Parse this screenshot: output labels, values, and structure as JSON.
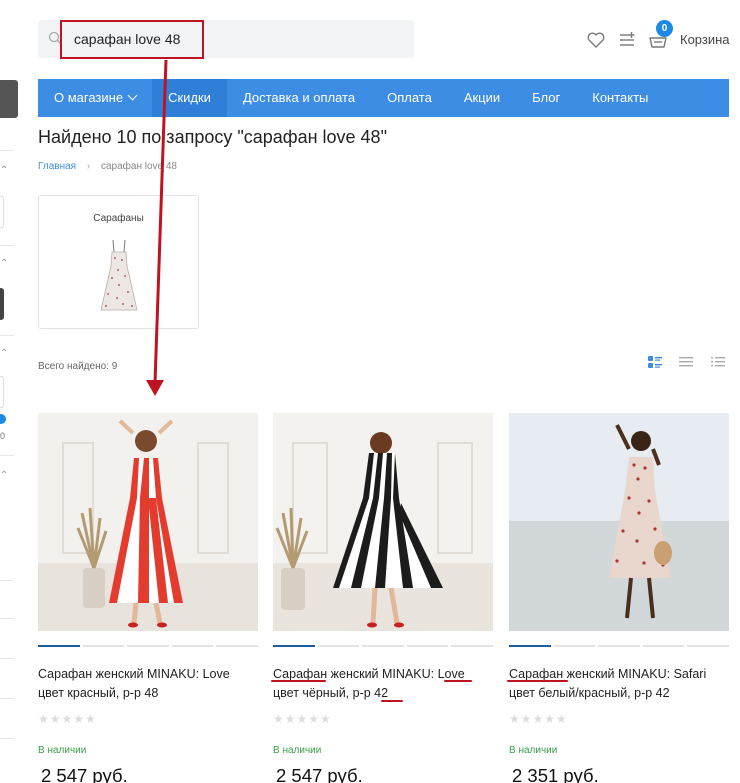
{
  "header": {
    "search_value": "сарафан love 48",
    "cart_count": "0",
    "cart_label": "Корзина"
  },
  "nav": [
    {
      "label": "О магазине"
    },
    {
      "label": "Скидки"
    },
    {
      "label": "Доставка и оплата"
    },
    {
      "label": "Оплата"
    },
    {
      "label": "Акции"
    },
    {
      "label": "Блог"
    },
    {
      "label": "Контакты"
    }
  ],
  "page_title": "Найдено 10 по запросу \"сарафан love 48\"",
  "breadcrumb": {
    "home": "Главная",
    "current": "сарафан love 48"
  },
  "category": {
    "label": "Сарафаны"
  },
  "total_found": "Всего найдено: 9",
  "products": [
    {
      "name": "Сарафан женский MINAKU: Love цвет красный, р-р 48",
      "stock": "В наличии",
      "price": "2 547 руб."
    },
    {
      "name": "Сарафан женский MINAKU: Love цвет чёрный, р-р 42",
      "stock": "В наличии",
      "price": "2 547 руб."
    },
    {
      "name": "Сарафан женский MINAKU: Safari цвет белый/красный, р-р 42",
      "stock": "В наличии",
      "price": "2 351 руб."
    }
  ],
  "colors": {
    "accent": "#3d8de4",
    "annotation": "#c01322",
    "in_stock": "#3aa04a"
  },
  "icons": [
    "search-icon",
    "heart-icon",
    "compare-icon",
    "cart-icon",
    "grid-view-icon",
    "list-view-icon",
    "table-view-icon"
  ]
}
